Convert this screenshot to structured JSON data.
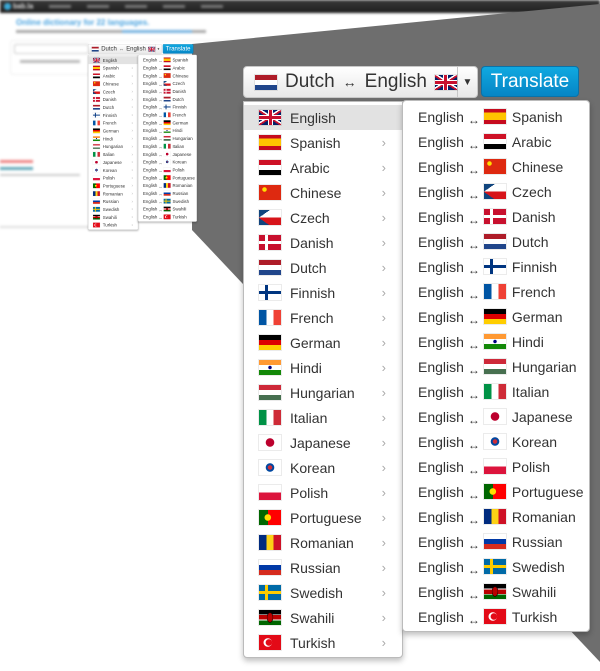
{
  "site": {
    "logo": "bab.la",
    "headline": "Online dictionary for 22 languages."
  },
  "selector": {
    "from": "Dutch",
    "to": "English",
    "from_flag": "nl",
    "to_flag": "en",
    "arrow": "↔",
    "caret": "▼",
    "translate_label": "Translate"
  },
  "colors": {
    "translate_button": "#0a8fd0",
    "active_row": "#e2e2e2",
    "overlay": "#6e6e6e"
  },
  "languages": [
    {
      "name": "English",
      "flag": "en",
      "active": true
    },
    {
      "name": "Spanish",
      "flag": "es"
    },
    {
      "name": "Arabic",
      "flag": "ar"
    },
    {
      "name": "Chinese",
      "flag": "zh"
    },
    {
      "name": "Czech",
      "flag": "cs"
    },
    {
      "name": "Danish",
      "flag": "da"
    },
    {
      "name": "Dutch",
      "flag": "nl"
    },
    {
      "name": "Finnish",
      "flag": "fi"
    },
    {
      "name": "French",
      "flag": "fr"
    },
    {
      "name": "German",
      "flag": "de"
    },
    {
      "name": "Hindi",
      "flag": "hi"
    },
    {
      "name": "Hungarian",
      "flag": "hu"
    },
    {
      "name": "Italian",
      "flag": "it"
    },
    {
      "name": "Japanese",
      "flag": "ja"
    },
    {
      "name": "Korean",
      "flag": "ko"
    },
    {
      "name": "Polish",
      "flag": "pl"
    },
    {
      "name": "Portuguese",
      "flag": "pt"
    },
    {
      "name": "Romanian",
      "flag": "ro"
    },
    {
      "name": "Russian",
      "flag": "ru"
    },
    {
      "name": "Swedish",
      "flag": "sv"
    },
    {
      "name": "Swahili",
      "flag": "sw"
    },
    {
      "name": "Turkish",
      "flag": "tr"
    }
  ],
  "submenu": {
    "source": "English",
    "arrow": "↔",
    "chevron": "›",
    "targets": [
      {
        "name": "Spanish",
        "flag": "es"
      },
      {
        "name": "Arabic",
        "flag": "ar"
      },
      {
        "name": "Chinese",
        "flag": "zh"
      },
      {
        "name": "Czech",
        "flag": "cs"
      },
      {
        "name": "Danish",
        "flag": "da"
      },
      {
        "name": "Dutch",
        "flag": "nl"
      },
      {
        "name": "Finnish",
        "flag": "fi"
      },
      {
        "name": "French",
        "flag": "fr"
      },
      {
        "name": "German",
        "flag": "de"
      },
      {
        "name": "Hindi",
        "flag": "hi"
      },
      {
        "name": "Hungarian",
        "flag": "hu"
      },
      {
        "name": "Italian",
        "flag": "it"
      },
      {
        "name": "Japanese",
        "flag": "ja"
      },
      {
        "name": "Korean",
        "flag": "ko"
      },
      {
        "name": "Polish",
        "flag": "pl"
      },
      {
        "name": "Portuguese",
        "flag": "pt"
      },
      {
        "name": "Romanian",
        "flag": "ro"
      },
      {
        "name": "Russian",
        "flag": "ru"
      },
      {
        "name": "Swedish",
        "flag": "sv"
      },
      {
        "name": "Swahili",
        "flag": "sw"
      },
      {
        "name": "Turkish",
        "flag": "tr"
      }
    ]
  }
}
